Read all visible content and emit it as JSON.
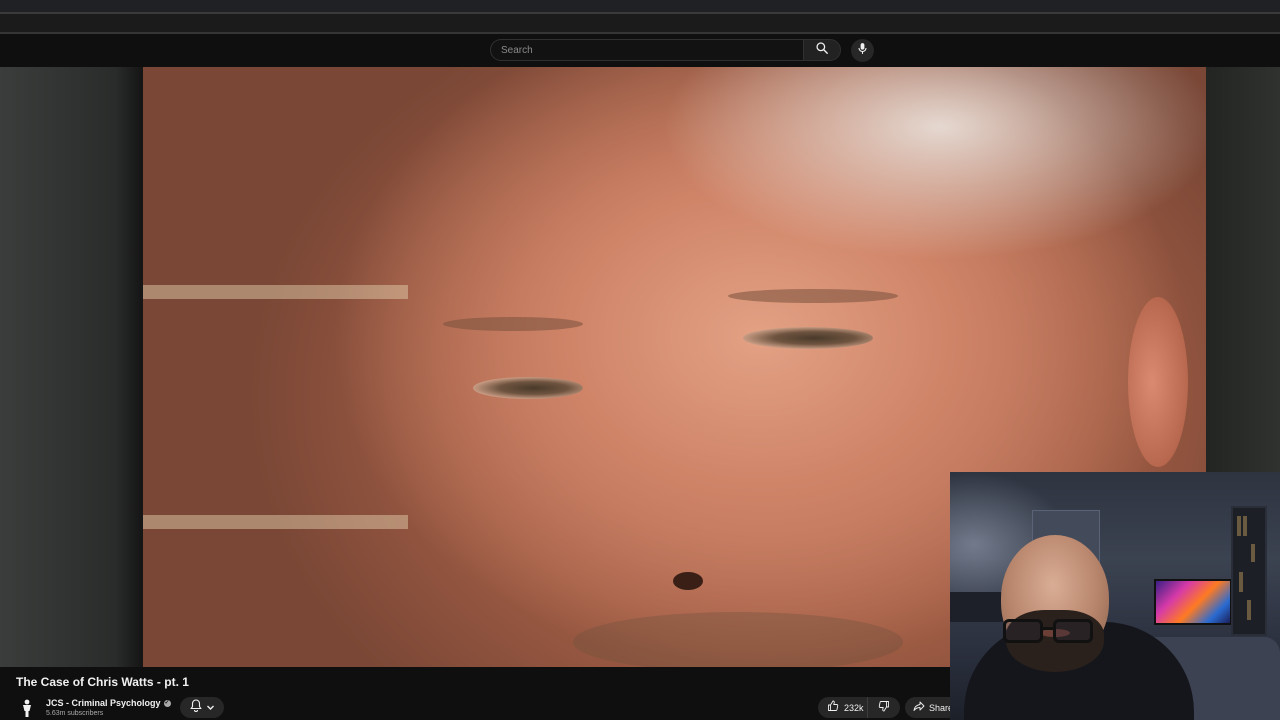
{
  "search": {
    "placeholder": "Search"
  },
  "video": {
    "title": "The Case of Chris Watts - pt. 1"
  },
  "channel": {
    "name": "JCS - Criminal Psychology",
    "subscribers": "5.63m subscribers"
  },
  "actions": {
    "like_count": "232k",
    "share_label": "Share"
  },
  "icons": {
    "search": "search-icon",
    "mic": "mic-icon",
    "bell": "bell-icon",
    "chevron": "chevron-down-icon",
    "like": "thumbs-up-icon",
    "dislike": "thumbs-down-icon",
    "share": "share-arrow-icon",
    "verified": "verified-check-icon"
  },
  "colors": {
    "background": "#0f0f0f",
    "button": "#272727",
    "text": "#f1f1f1",
    "muted_text": "#aaaaaa"
  }
}
